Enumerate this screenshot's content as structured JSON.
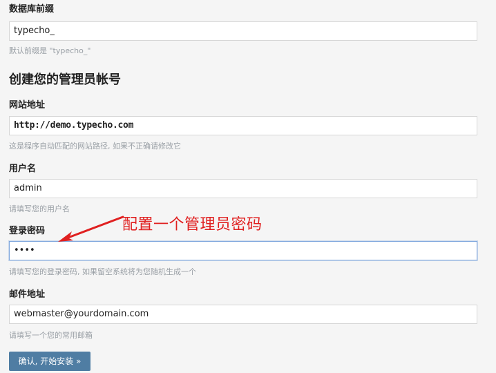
{
  "fields": {
    "db_prefix": {
      "label": "数据库前缀",
      "value": "typecho_",
      "hint": "默认前缀是 \"typecho_\""
    },
    "site_url": {
      "label": "网站地址",
      "value": "http://demo.typecho.com",
      "hint": "这是程序自动匹配的网站路径, 如果不正确请修改它"
    },
    "username": {
      "label": "用户名",
      "value": "admin",
      "hint": "请填写您的用户名"
    },
    "password": {
      "label": "登录密码",
      "value": "••••",
      "hint": "请填写您的登录密码, 如果留空系统将为您随机生成一个"
    },
    "email": {
      "label": "邮件地址",
      "value": "webmaster@yourdomain.com",
      "hint": "请填写一个您的常用邮箱"
    }
  },
  "section_title": "创建您的管理员帐号",
  "submit_label": "确认, 开始安装 »",
  "annotation": {
    "text": "配置一个管理员密码",
    "color": "#e02020"
  },
  "colors": {
    "page_bg": "#f5f5f5",
    "input_border": "#d6d6d6",
    "focus_border": "#7ea6dd",
    "button_bg": "#4f7da3",
    "hint_text": "#9aa0a6"
  }
}
